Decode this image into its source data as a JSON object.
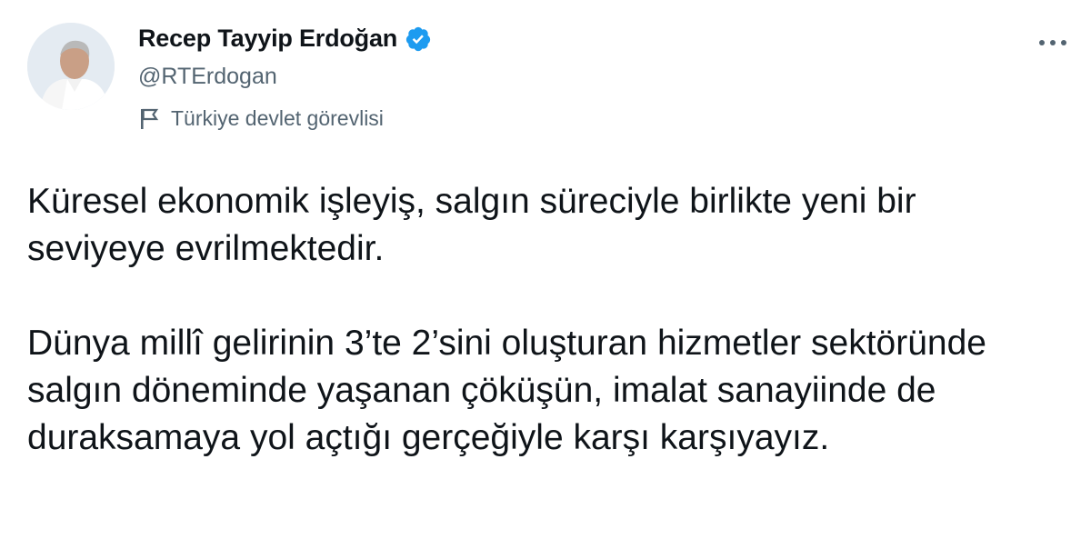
{
  "author": {
    "display_name": "Recep Tayyip Erdoğan",
    "handle": "@RTErdogan",
    "verified_icon": "verified-badge-icon",
    "label": "Türkiye devlet görevlisi",
    "label_icon": "flag-icon"
  },
  "actions": {
    "more_icon": "more-options-icon"
  },
  "tweet": {
    "paragraphs": [
      "Küresel ekonomik işleyiş, salgın süreciyle birlikte yeni bir seviyeye evrilmektedir.",
      "Dünya millî gelirinin 3’te 2’sini oluşturan hizmetler sektöründe salgın döneminde yaşanan çöküşün, imalat sanayiinde de duraksamaya yol açtığı gerçeğiyle karşı karşıyayız."
    ]
  },
  "colors": {
    "primary_text": "#0f1419",
    "secondary_text": "#536471",
    "verified_blue": "#1d9bf0",
    "background": "#ffffff"
  }
}
